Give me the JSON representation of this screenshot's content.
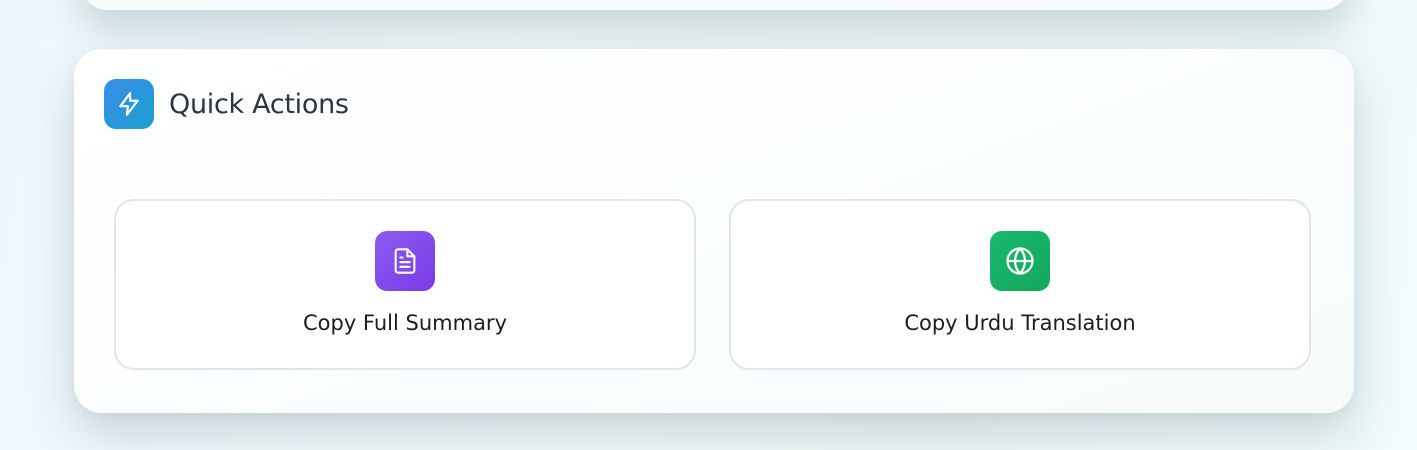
{
  "panel": {
    "title": "Quick Actions",
    "icon": "lightning-icon",
    "accent": "#2d93e0"
  },
  "actions": [
    {
      "label": "Copy Full Summary",
      "icon": "document-icon",
      "color": "#8248ea"
    },
    {
      "label": "Copy Urdu Translation",
      "icon": "globe-icon",
      "color": "#14ae64"
    }
  ]
}
